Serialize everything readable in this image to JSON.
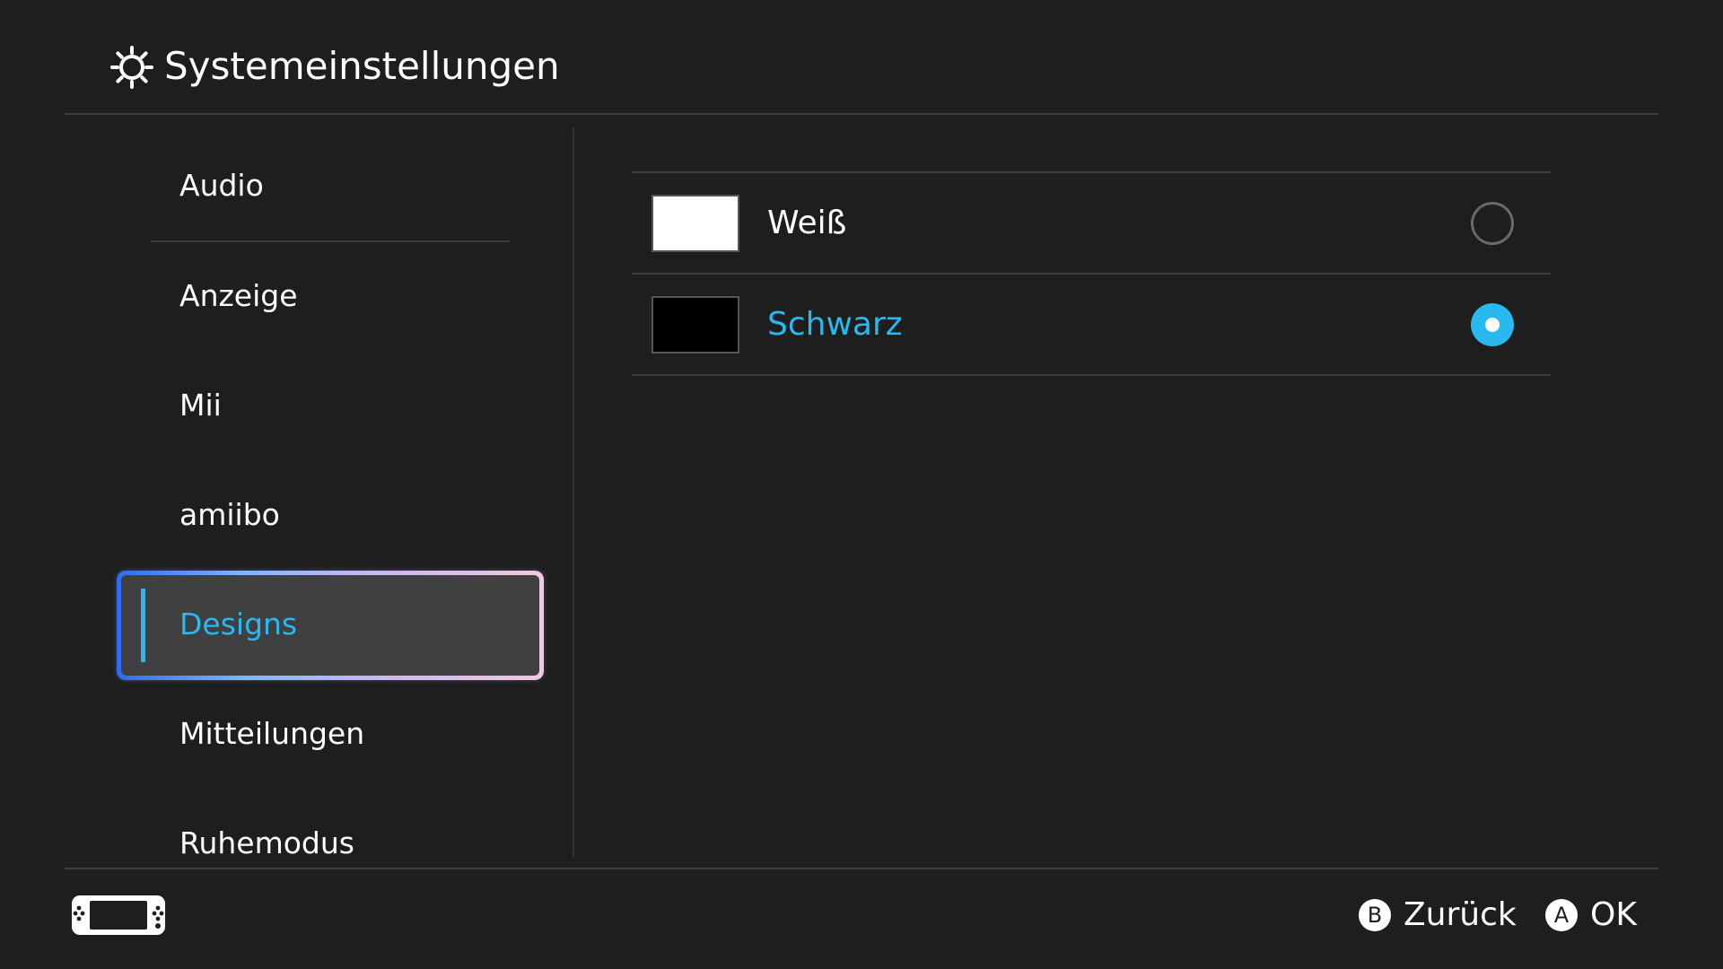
{
  "header": {
    "title": "Systemeinstellungen",
    "icon": "gear-icon"
  },
  "sidebar": {
    "items": [
      {
        "label": "Audio"
      },
      {
        "label": "Anzeige"
      },
      {
        "label": "Mii"
      },
      {
        "label": "amiibo"
      },
      {
        "label": "Designs",
        "selected": true
      },
      {
        "label": "Mitteilungen"
      },
      {
        "label": "Ruhemodus"
      }
    ]
  },
  "main": {
    "options": [
      {
        "label": "Weiß",
        "swatch_color": "#ffffff",
        "checked": false
      },
      {
        "label": "Schwarz",
        "swatch_color": "#000000",
        "checked": true
      }
    ]
  },
  "footer": {
    "console_icon": "handheld-console-icon",
    "back": {
      "glyph": "B",
      "label": "Zurück"
    },
    "ok": {
      "glyph": "A",
      "label": "OK"
    }
  },
  "colors": {
    "background": "#1e1e1e",
    "accent": "#2ab8f0",
    "selected_item_bg": "#404040",
    "divider": "#3d3d3d"
  }
}
